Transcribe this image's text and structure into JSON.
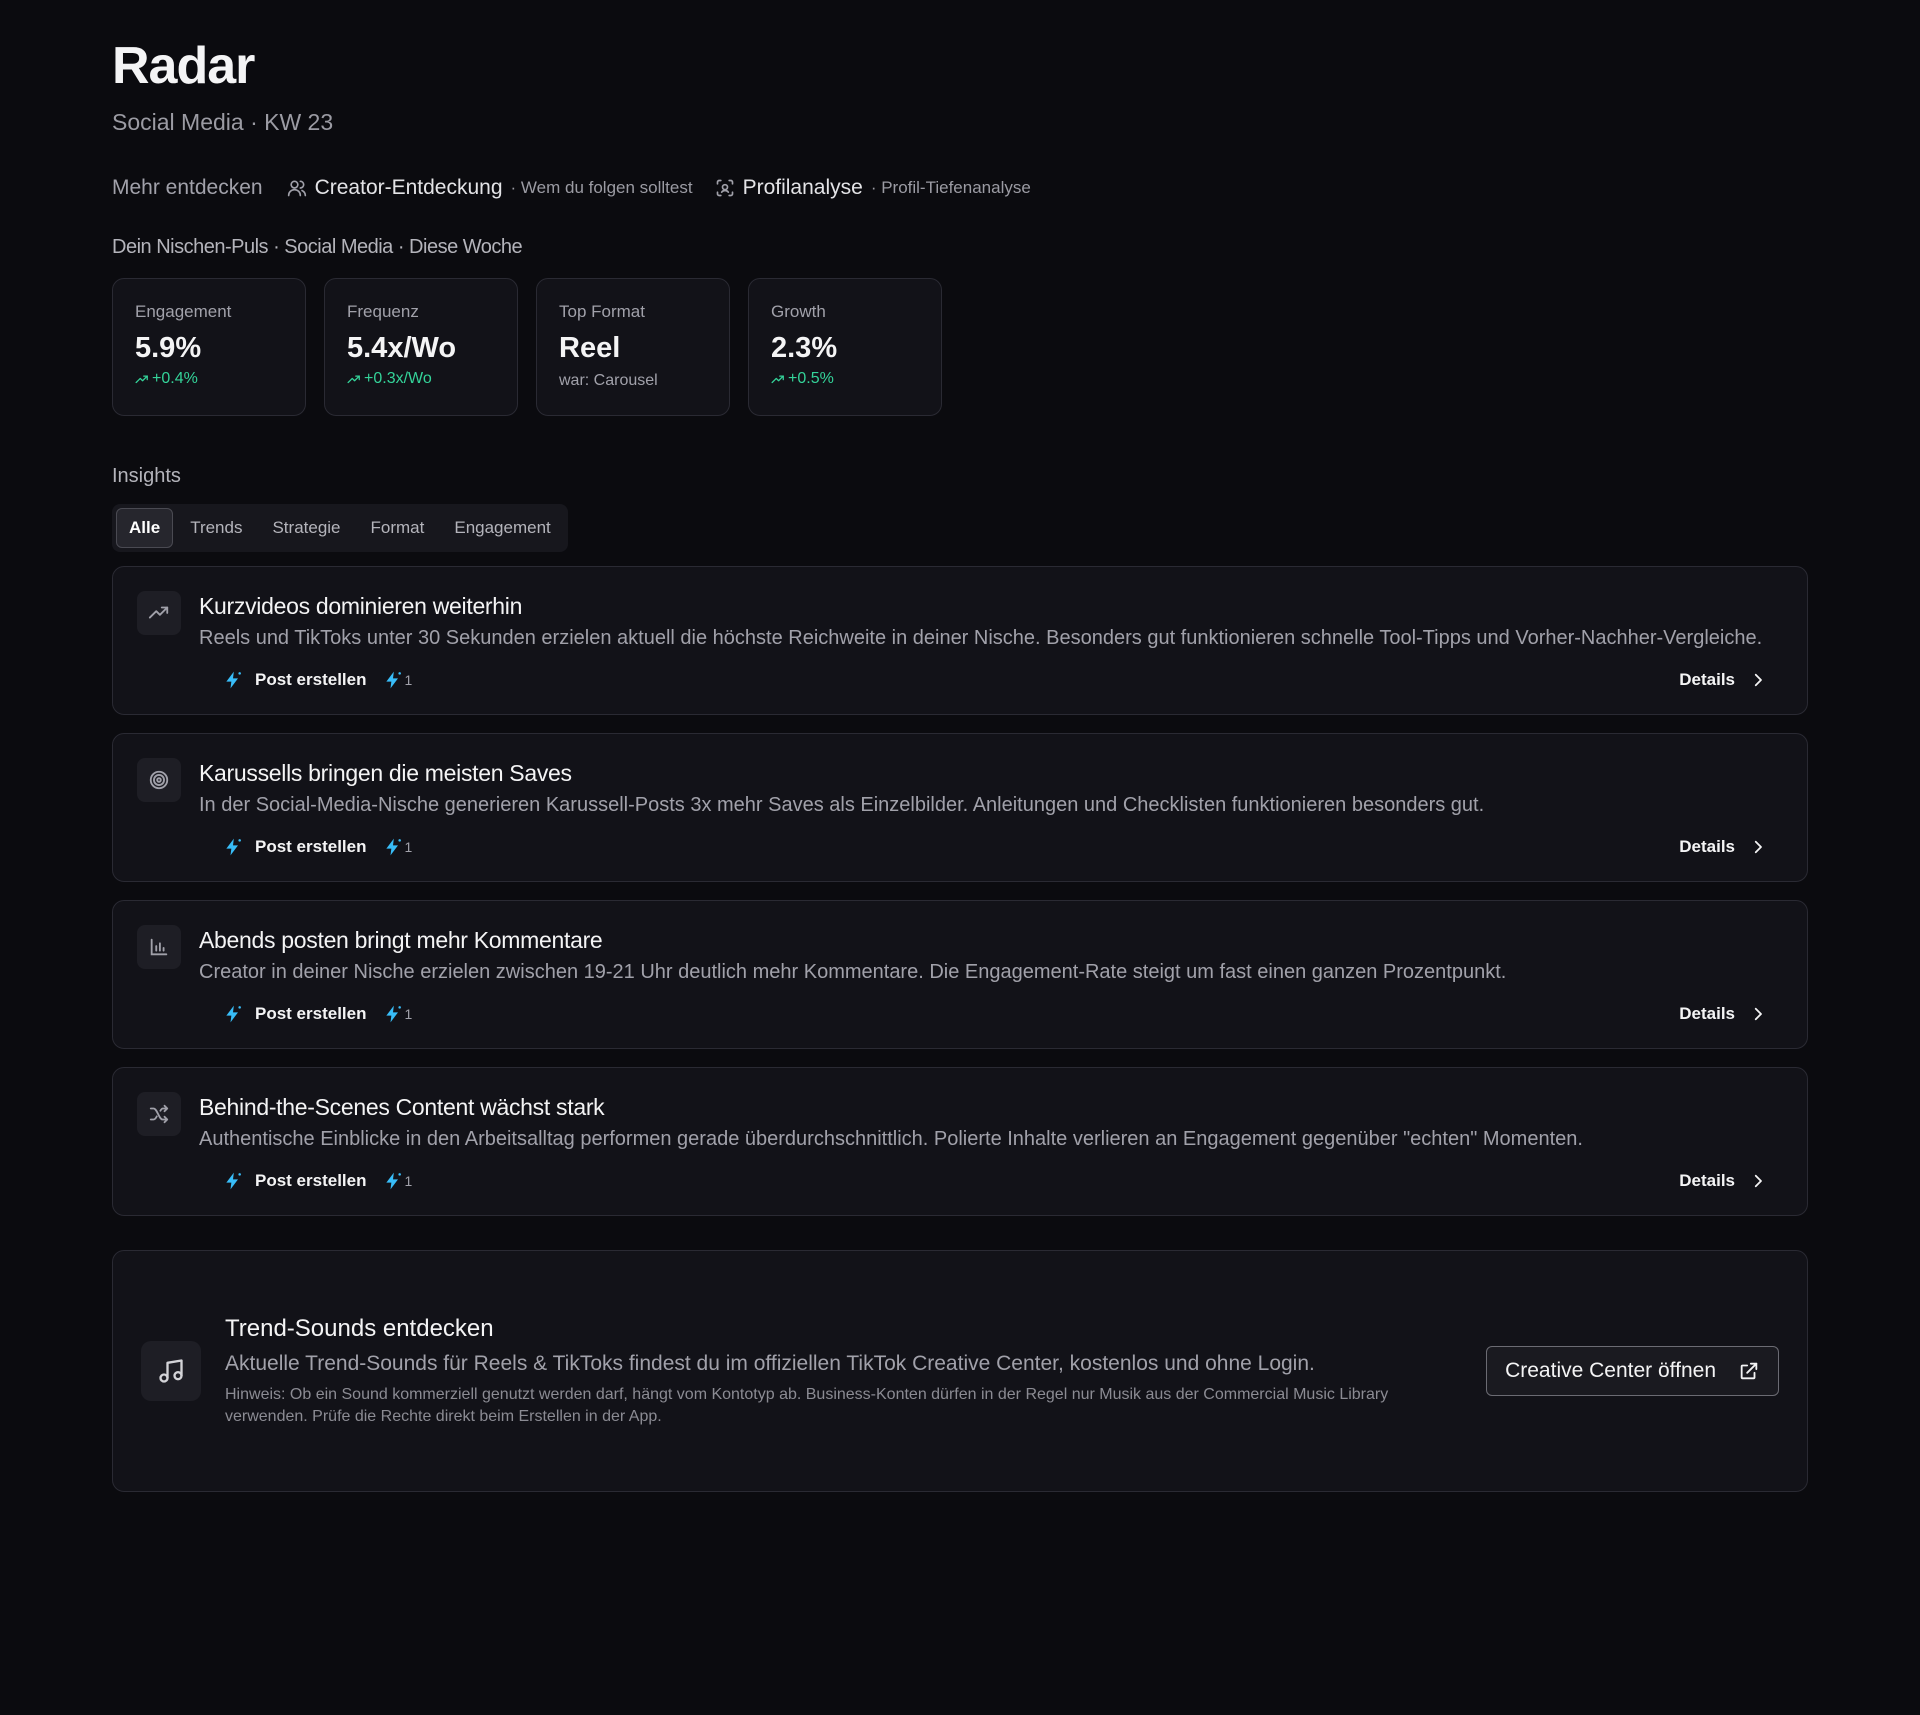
{
  "header": {
    "title": "Radar",
    "subtitle": "Social Media · KW 23"
  },
  "discover": {
    "lead": "Mehr entdecken",
    "items": [
      {
        "name": "Creator-Entdeckung",
        "desc": "· Wem du folgen solltest",
        "icon": "users-icon"
      },
      {
        "name": "Profilanalyse",
        "desc": "· Profil-Tiefenanalyse",
        "icon": "scan-face-icon"
      }
    ]
  },
  "pulse": {
    "label": "Dein Nischen-Puls · Social Media · Diese Woche",
    "stats": [
      {
        "label": "Engagement",
        "value": "5.9%",
        "delta": "+0.4%"
      },
      {
        "label": "Frequenz",
        "value": "5.4x/Wo",
        "delta": "+0.3x/Wo"
      },
      {
        "label": "Top Format",
        "value": "Reel",
        "was": "war: Carousel"
      },
      {
        "label": "Growth",
        "value": "2.3%",
        "delta": "+0.5%"
      }
    ]
  },
  "insights": {
    "label": "Insights",
    "tabs": [
      "Alle",
      "Trends",
      "Strategie",
      "Format",
      "Engagement"
    ],
    "active_tab": "Alle",
    "post_label": "Post erstellen",
    "credit": "1",
    "details_label": "Details",
    "cards": [
      {
        "icon": "trending-up-icon",
        "title": "Kurzvideos dominieren weiterhin",
        "body": "Reels und TikToks unter 30 Sekunden erzielen aktuell die höchste Reichweite in deiner Nische. Besonders gut funktionieren schnelle Tool-Tipps und Vorher-Nachher-Vergleiche."
      },
      {
        "icon": "target-icon",
        "title": "Karussells bringen die meisten Saves",
        "body": "In der Social-Media-Nische generieren Karussell-Posts 3x mehr Saves als Einzelbilder. Anleitungen und Checklisten funktionieren besonders gut."
      },
      {
        "icon": "bar-chart-icon",
        "title": "Abends posten bringt mehr Kommentare",
        "body": "Creator in deiner Nische erzielen zwischen 19-21 Uhr deutlich mehr Kommentare. Die Engagement-Rate steigt um fast einen ganzen Prozentpunkt."
      },
      {
        "icon": "shuffle-icon",
        "title": "Behind-the-Scenes Content wächst stark",
        "body": "Authentische Einblicke in den Arbeitsalltag performen gerade überdurchschnittlich. Polierte Inhalte verlieren an Engagement gegenüber \"echten\" Momenten."
      }
    ]
  },
  "sounds": {
    "icon": "music-icon",
    "title": "Trend-Sounds entdecken",
    "body": "Aktuelle Trend-Sounds für Reels & TikToks findest du im offiziellen TikTok Creative Center, kostenlos und ohne Login.",
    "note": "Hinweis: Ob ein Sound kommerziell genutzt werden darf, hängt vom Kontotyp ab. Business-Konten dürfen in der Regel nur Musik aus der Commercial Music Library verwenden. Prüfe die Rechte direkt beim Erstellen in der App.",
    "button": "Creative Center öffnen"
  },
  "colors": {
    "background": "#0b0b0f",
    "card": "#121218",
    "positive": "#34d399",
    "accent": "#38bdf8"
  }
}
